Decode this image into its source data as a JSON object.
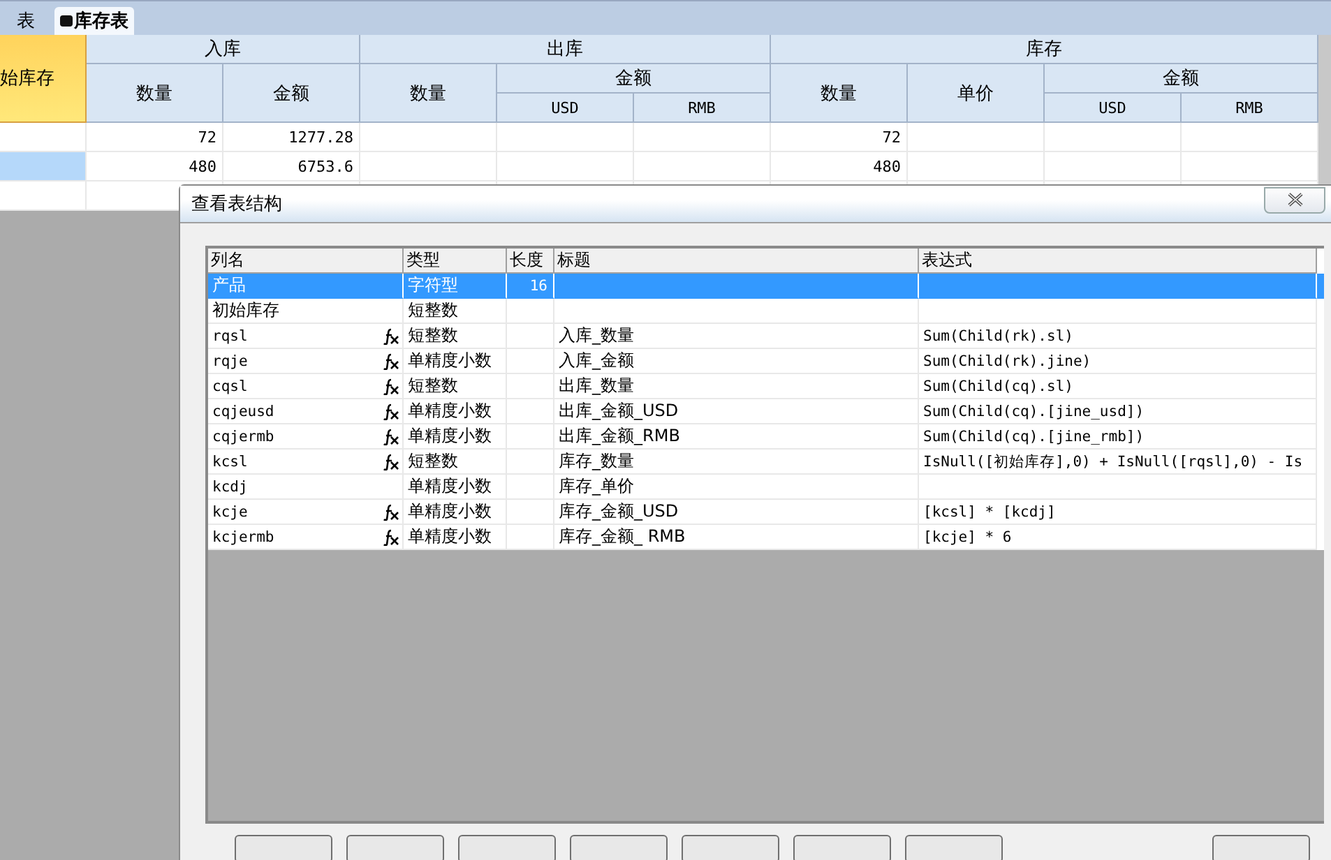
{
  "tabs": [
    {
      "label": "表",
      "selected": false,
      "icon": false
    },
    {
      "label": "库存表",
      "selected": true,
      "icon": true
    }
  ],
  "grid": {
    "first_column": "始库存",
    "groups": [
      {
        "label": "入库",
        "children": [
          {
            "label": "数量"
          },
          {
            "label": "金额"
          }
        ]
      },
      {
        "label": "出库",
        "children": [
          {
            "label": "数量"
          },
          {
            "label": "金额",
            "children": [
              {
                "label": "USD"
              },
              {
                "label": "RMB"
              }
            ]
          }
        ]
      },
      {
        "label": "库存",
        "children": [
          {
            "label": "数量"
          },
          {
            "label": "单价"
          },
          {
            "label": "金额",
            "children": [
              {
                "label": "USD"
              },
              {
                "label": "RMB"
              }
            ]
          }
        ]
      }
    ],
    "rows": [
      {
        "selected": false,
        "cells": [
          "",
          "72",
          "1277.28",
          "",
          "",
          "",
          "72",
          "",
          "",
          ""
        ]
      },
      {
        "selected": true,
        "cells": [
          "",
          "480",
          "6753.6",
          "",
          "",
          "",
          "480",
          "",
          "",
          ""
        ]
      },
      {
        "selected": false,
        "cells": [
          "",
          "",
          "",
          "",
          "",
          "",
          "",
          "",
          "",
          ""
        ]
      }
    ]
  },
  "dialog": {
    "title": "查看表结构",
    "columns": [
      "列名",
      "类型",
      "长度",
      "标题",
      "表达式"
    ],
    "rows": [
      {
        "name": "产品",
        "formula": false,
        "type": "字符型",
        "length": "16",
        "caption": "",
        "expression": "",
        "selected": true
      },
      {
        "name": "初始库存",
        "formula": false,
        "type": "短整数",
        "length": "",
        "caption": "",
        "expression": "",
        "selected": false
      },
      {
        "name": "rqsl",
        "formula": true,
        "type": "短整数",
        "length": "",
        "caption": "入库_数量",
        "expression": "Sum(Child(rk).sl)",
        "selected": false
      },
      {
        "name": "rqje",
        "formula": true,
        "type": "单精度小数",
        "length": "",
        "caption": "入库_金额",
        "expression": "Sum(Child(rk).jine)",
        "selected": false
      },
      {
        "name": "cqsl",
        "formula": true,
        "type": "短整数",
        "length": "",
        "caption": "出库_数量",
        "expression": "Sum(Child(cq).sl)",
        "selected": false
      },
      {
        "name": "cqjeusd",
        "formula": true,
        "type": "单精度小数",
        "length": "",
        "caption": "出库_金额_USD",
        "expression": "Sum(Child(cq).[jine_usd])",
        "selected": false
      },
      {
        "name": "cqjermb",
        "formula": true,
        "type": "单精度小数",
        "length": "",
        "caption": "出库_金额_RMB",
        "expression": "Sum(Child(cq).[jine_rmb])",
        "selected": false
      },
      {
        "name": "kcsl",
        "formula": true,
        "type": "短整数",
        "length": "",
        "caption": "库存_数量",
        "expression": "IsNull([初始库存],0) + IsNull([rqsl],0) - Is",
        "selected": false
      },
      {
        "name": "kcdj",
        "formula": false,
        "type": "单精度小数",
        "length": "",
        "caption": "库存_单价",
        "expression": "",
        "selected": false
      },
      {
        "name": "kcje",
        "formula": true,
        "type": "单精度小数",
        "length": "",
        "caption": "库存_金额_USD",
        "expression": "[kcsl] * [kcdj]",
        "selected": false
      },
      {
        "name": "kcjermb",
        "formula": true,
        "type": "单精度小数",
        "length": "",
        "caption": "库存_金额_ RMB",
        "expression": "[kcje] * 6",
        "selected": false
      }
    ]
  }
}
